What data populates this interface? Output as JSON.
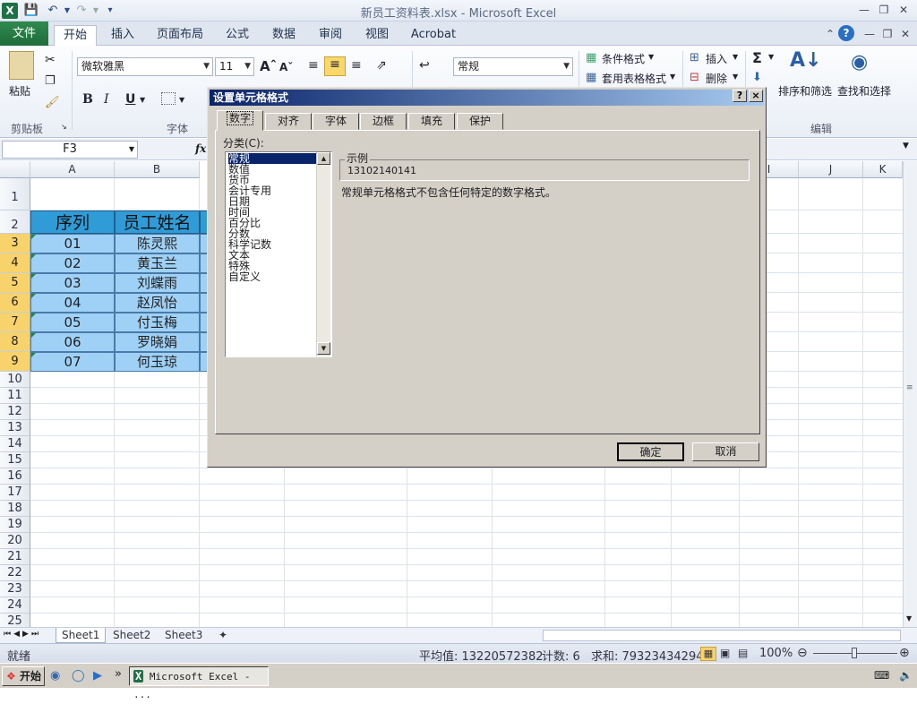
{
  "window": {
    "title": "新员工资料表.xlsx  -  Microsoft Excel"
  },
  "ribbon_tabs": [
    "文件",
    "开始",
    "插入",
    "页面布局",
    "公式",
    "数据",
    "审阅",
    "视图",
    "Acrobat"
  ],
  "ribbon": {
    "paste_label": "粘贴",
    "clipboard_group": "剪贴板",
    "font_group": "字体",
    "font_name": "微软雅黑",
    "font_size": "11",
    "number_format": "常规",
    "conditional_format": "条件格式",
    "table_format": "套用表格格式",
    "insert": "插入",
    "delete": "删除",
    "sort_filter": "排序和筛选",
    "find_select": "查找和选择",
    "edit_group": "编辑"
  },
  "formula_bar": {
    "name_box": "F3",
    "fx": "fx"
  },
  "columns": [
    "A",
    "B",
    "I",
    "J",
    "K"
  ],
  "rows": [
    "1",
    "2",
    "3",
    "4",
    "5",
    "6",
    "7",
    "8",
    "9",
    "10",
    "11",
    "12",
    "13",
    "14",
    "15",
    "16",
    "17",
    "18",
    "19",
    "20",
    "21",
    "22",
    "23",
    "24",
    "25"
  ],
  "table": {
    "headers": [
      "序列",
      "员工姓名"
    ],
    "rows": [
      [
        "01",
        "陈灵熙"
      ],
      [
        "02",
        "黄玉兰"
      ],
      [
        "03",
        "刘蝶雨"
      ],
      [
        "04",
        "赵凤怡"
      ],
      [
        "05",
        "付玉梅"
      ],
      [
        "06",
        "罗晓娟"
      ],
      [
        "07",
        "何玉琼"
      ]
    ]
  },
  "sheets": [
    "Sheet1",
    "Sheet2",
    "Sheet3"
  ],
  "status": {
    "ready": "就绪",
    "average": "平均值: 13220572382",
    "count": "计数: 6",
    "sum": "求和: 79323434294",
    "zoom": "100%"
  },
  "taskbar": {
    "start": "开始",
    "app": "Microsoft Excel - ..."
  },
  "dialog": {
    "title": "设置单元格格式",
    "help": "?",
    "close": "×",
    "tabs": [
      "数字",
      "对齐",
      "字体",
      "边框",
      "填充",
      "保护"
    ],
    "category_label": "分类(C):",
    "categories": [
      "常规",
      "数值",
      "货币",
      "会计专用",
      "日期",
      "时间",
      "百分比",
      "分数",
      "科学记数",
      "文本",
      "特殊",
      "自定义"
    ],
    "sample_label": "示例",
    "sample_value": "13102140141",
    "description": "常规单元格格式不包含任何特定的数字格式。",
    "ok": "确定",
    "cancel": "取消"
  }
}
